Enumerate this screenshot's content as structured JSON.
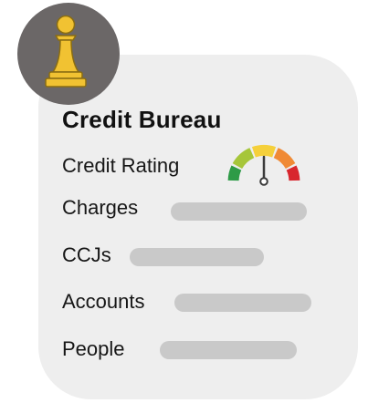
{
  "card": {
    "title": "Credit Bureau",
    "rows": [
      {
        "label": "Credit Rating"
      },
      {
        "label": "Charges"
      },
      {
        "label": "CCJs"
      },
      {
        "label": "Accounts"
      },
      {
        "label": "People"
      }
    ]
  },
  "colors": {
    "card_background": "#eeeeee",
    "avatar_background": "#6b6767",
    "pawn": "#f1c232",
    "bar": "#c9c9c9",
    "gauge_segments": [
      "#d8262d",
      "#f08a35",
      "#f5d03b",
      "#a6c63a",
      "#2e9b47"
    ]
  },
  "icons": {
    "avatar": "chess-pawn-icon",
    "rating": "gauge-icon"
  }
}
